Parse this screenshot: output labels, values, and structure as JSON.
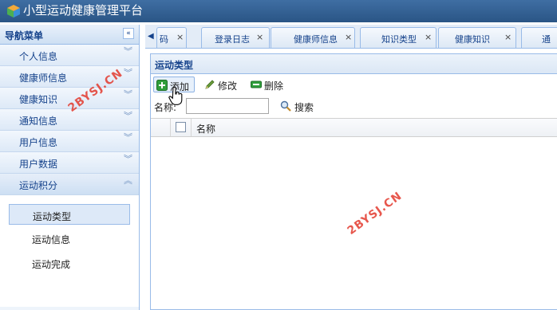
{
  "app": {
    "title": "小型运动健康管理平台"
  },
  "sidebar": {
    "title": "导航菜单",
    "collapse_glyph": "«",
    "items": [
      {
        "label": "个人信息",
        "chevron": "»"
      },
      {
        "label": "健康师信息",
        "chevron": "»"
      },
      {
        "label": "健康知识",
        "chevron": "»"
      },
      {
        "label": "通知信息",
        "chevron": "»"
      },
      {
        "label": "用户信息",
        "chevron": "»"
      },
      {
        "label": "用户数据",
        "chevron": "»"
      },
      {
        "label": "运动积分",
        "chevron": "«"
      }
    ],
    "sub_items": [
      {
        "label": "运动类型",
        "active": true
      },
      {
        "label": "运动信息",
        "active": false
      },
      {
        "label": "运动完成",
        "active": false
      }
    ]
  },
  "tabs": [
    {
      "label": "码",
      "close": "×"
    },
    {
      "label": "登录日志",
      "close": "×"
    },
    {
      "label": "健康师信息",
      "close": "×"
    },
    {
      "label": "知识类型",
      "close": "×"
    },
    {
      "label": "健康知识",
      "close": "×"
    },
    {
      "label": "通",
      "close": ""
    }
  ],
  "panel": {
    "title": "运动类型",
    "toolbar": {
      "add": "添加",
      "edit": "修改",
      "delete": "删除"
    },
    "search": {
      "label": "名称:",
      "value": "",
      "button": "搜索"
    },
    "grid": {
      "columns": [
        "名称"
      ]
    }
  },
  "watermark": "2BYSJ.CN",
  "colors": {
    "header_bg": "#2a5585",
    "accent": "#15428b",
    "border": "#99bbe8",
    "watermark": "#e33a2e"
  },
  "icons": {
    "logo": "cube-logo-icon",
    "add": "plus-icon",
    "edit": "pencil-icon",
    "delete": "minus-icon",
    "search": "magnifier-icon"
  }
}
